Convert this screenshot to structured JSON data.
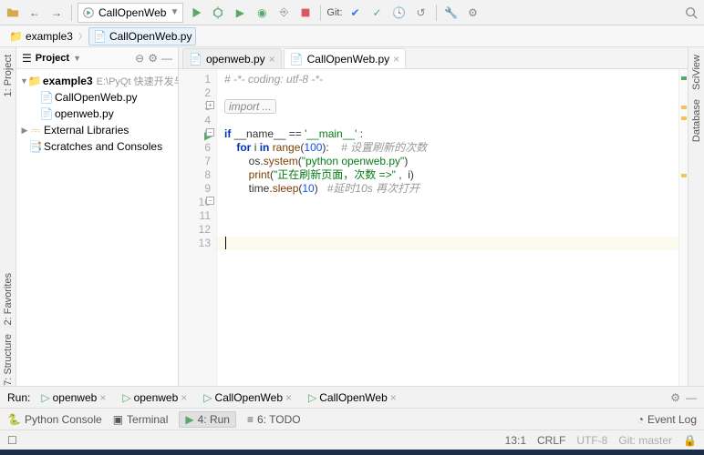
{
  "toolbar": {
    "run_config": "CallOpenWeb",
    "git_label": "Git:"
  },
  "breadcrumb": {
    "folder": "example3",
    "file": "CallOpenWeb.py"
  },
  "left_rail": {
    "project": "1: Project",
    "favorites": "2: Favorites",
    "structure": "7: Structure"
  },
  "project_panel": {
    "title": "Project",
    "tree": {
      "root": "example3",
      "root_hint": "E:\\PyQt 快速开发与实战\\P",
      "files": [
        "CallOpenWeb.py",
        "openweb.py"
      ],
      "ext_libs": "External Libraries",
      "scratches": "Scratches and Consoles"
    }
  },
  "tabs": [
    {
      "label": "openweb.py",
      "active": false
    },
    {
      "label": "CallOpenWeb.py",
      "active": true
    }
  ],
  "code": {
    "lines": [
      {
        "n": 1,
        "segs": [
          {
            "t": "# -*- coding: utf-8 -*-",
            "c": "cm"
          }
        ]
      },
      {
        "n": 2,
        "segs": []
      },
      {
        "n": 3,
        "segs": [
          {
            "t": "import ...",
            "c": "folded"
          }
        ]
      },
      {
        "n": 4,
        "segs": []
      },
      {
        "n": 5,
        "segs": [
          {
            "t": "if ",
            "c": "kw"
          },
          {
            "t": "__name__ == ",
            "c": ""
          },
          {
            "t": "'__main__'",
            "c": "str"
          },
          {
            "t": " :",
            "c": ""
          }
        ]
      },
      {
        "n": 6,
        "segs": [
          {
            "t": "    ",
            "c": ""
          },
          {
            "t": "for ",
            "c": "kw"
          },
          {
            "t": "i ",
            "c": ""
          },
          {
            "t": "in ",
            "c": "kw"
          },
          {
            "t": "range",
            "c": "fn"
          },
          {
            "t": "(",
            "c": ""
          },
          {
            "t": "100",
            "c": "num"
          },
          {
            "t": "):    ",
            "c": ""
          },
          {
            "t": "# 设置刷新的次数",
            "c": "cm"
          }
        ]
      },
      {
        "n": 7,
        "segs": [
          {
            "t": "        os.",
            "c": ""
          },
          {
            "t": "system",
            "c": "fn"
          },
          {
            "t": "(",
            "c": ""
          },
          {
            "t": "\"python openweb.py\"",
            "c": "str"
          },
          {
            "t": ")",
            "c": ""
          }
        ]
      },
      {
        "n": 8,
        "segs": [
          {
            "t": "        ",
            "c": ""
          },
          {
            "t": "print",
            "c": "fn"
          },
          {
            "t": "(",
            "c": ""
          },
          {
            "t": "\"正在刷新页面，次数 =>\"",
            "c": "str"
          },
          {
            "t": " ,  i)",
            "c": ""
          }
        ]
      },
      {
        "n": 9,
        "segs": [
          {
            "t": "        time.",
            "c": ""
          },
          {
            "t": "sleep",
            "c": "fn"
          },
          {
            "t": "(",
            "c": ""
          },
          {
            "t": "10",
            "c": "num"
          },
          {
            "t": ")   ",
            "c": ""
          },
          {
            "t": "#延时10s 再次打开",
            "c": "cm"
          }
        ]
      },
      {
        "n": 10,
        "segs": []
      },
      {
        "n": 11,
        "segs": []
      },
      {
        "n": 12,
        "segs": []
      },
      {
        "n": 13,
        "segs": []
      }
    ],
    "current_line": 13
  },
  "right_rail": {
    "sciview": "SciView",
    "database": "Database"
  },
  "run_bar": {
    "label": "Run:",
    "tabs": [
      "openweb",
      "openweb",
      "CallOpenWeb",
      "CallOpenWeb"
    ]
  },
  "tool_bar": {
    "python_console": "Python Console",
    "terminal": "Terminal",
    "run": "4: Run",
    "todo": "6: TODO",
    "event_log": "Event Log"
  },
  "status_bar": {
    "pos": "13:1",
    "eol": "CRLF",
    "enc": "UTF-8",
    "git": "Git: master"
  }
}
